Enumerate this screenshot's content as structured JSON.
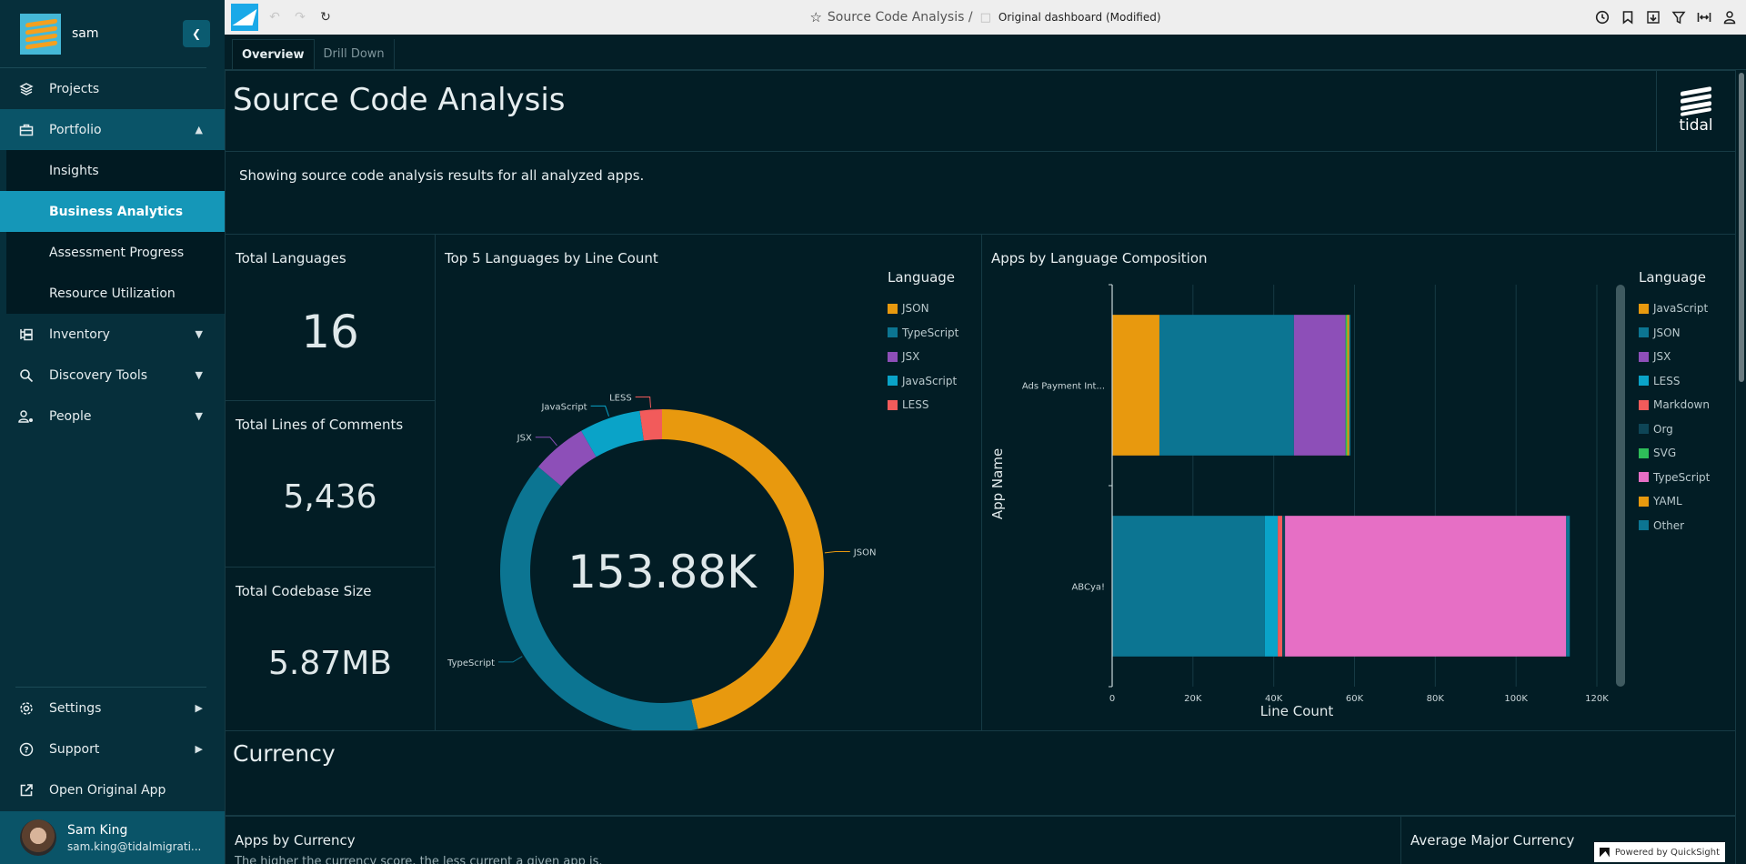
{
  "sidebar": {
    "username": "sam",
    "nav": [
      {
        "label": "Projects",
        "icon": "layers-icon"
      },
      {
        "label": "Portfolio",
        "icon": "briefcase-icon",
        "expanded": true
      },
      {
        "label": "Inventory",
        "icon": "inventory-icon"
      },
      {
        "label": "Discovery Tools",
        "icon": "search-icon"
      },
      {
        "label": "People",
        "icon": "people-settings-icon"
      }
    ],
    "portfolio_sub": [
      {
        "label": "Insights"
      },
      {
        "label": "Business Analytics",
        "active": true
      },
      {
        "label": "Assessment Progress"
      },
      {
        "label": "Resource Utilization"
      }
    ],
    "bottom": [
      {
        "label": "Settings",
        "icon": "gear-icon"
      },
      {
        "label": "Support",
        "icon": "help-icon"
      },
      {
        "label": "Open Original App",
        "icon": "external-link-icon"
      }
    ],
    "profile": {
      "name": "Sam King",
      "email": "sam.king@tidalmigrati..."
    }
  },
  "topbar": {
    "title": "Source Code Analysis /",
    "subtitle": "Original dashboard (Modified)",
    "right_icons": [
      "clock-icon",
      "bookmark-icon",
      "download-icon",
      "filter-icon",
      "fit-width-icon",
      "user-icon"
    ]
  },
  "tabs": [
    {
      "label": "Overview",
      "active": true
    },
    {
      "label": "Drill Down"
    }
  ],
  "dashboard": {
    "title": "Source Code Analysis",
    "logo_text": "tidal",
    "description": "Showing source code analysis results for all analyzed apps.",
    "kpis": [
      {
        "title": "Total Languages",
        "value": "16"
      },
      {
        "title": "Total Lines of Comments",
        "value": "5,436"
      },
      {
        "title": "Total Codebase Size",
        "value": "5.87MB"
      }
    ],
    "section_title": "Currency",
    "bottom_panels": [
      {
        "title": "Apps by Currency",
        "subtitle": "The higher the currency score, the less current a given app is."
      },
      {
        "title": "Average Major Currency"
      }
    ],
    "powered_by": "Powered by QuickSight"
  },
  "chart_data": [
    {
      "type": "pie",
      "title": "Top 5 Languages by Line Count",
      "center_label": "153.88K",
      "legend_title": "Language",
      "legend_position": "right",
      "slices": [
        {
          "label": "JSON",
          "value": 71.4,
          "color": "#e8990e"
        },
        {
          "label": "TypeScript",
          "value": 61.1,
          "color": "#0c7592"
        },
        {
          "label": "JSX",
          "value": 8.5,
          "color": "#8d4fb8"
        },
        {
          "label": "JavaScript",
          "value": 9.4,
          "color": "#0aa3c8"
        },
        {
          "label": "LESS",
          "value": 3.4,
          "color": "#f25b5b"
        }
      ],
      "units": "thousand lines"
    },
    {
      "type": "bar",
      "orientation": "horizontal",
      "stacked": true,
      "title": "Apps by Language Composition",
      "xlabel": "Line Count",
      "ylabel": "App Name",
      "xlim": [
        0,
        120000
      ],
      "xticks": [
        "0",
        "20K",
        "40K",
        "60K",
        "80K",
        "100K",
        "120K"
      ],
      "categories": [
        "Ads Payment Int...",
        "ABCya!"
      ],
      "legend_title": "Language",
      "legend_position": "right",
      "series": [
        {
          "name": "JavaScript",
          "color": "#e8990e",
          "values": [
            11700,
            0
          ]
        },
        {
          "name": "JSON",
          "color": "#0c7592",
          "values": [
            33300,
            37800
          ]
        },
        {
          "name": "JSX",
          "color": "#8d4fb8",
          "values": [
            12800,
            0
          ]
        },
        {
          "name": "LESS",
          "color": "#0aa3c8",
          "values": [
            0,
            3200
          ]
        },
        {
          "name": "Markdown",
          "color": "#f25b5b",
          "values": [
            0,
            1100
          ]
        },
        {
          "name": "Org",
          "color": "#0e4556",
          "values": [
            0,
            700
          ]
        },
        {
          "name": "SVG",
          "color": "#2ebd59",
          "values": [
            400,
            0
          ]
        },
        {
          "name": "TypeScript",
          "color": "#e66fc5",
          "values": [
            0,
            69600
          ]
        },
        {
          "name": "YAML",
          "color": "#e8990e",
          "values": [
            500,
            0
          ]
        },
        {
          "name": "Other",
          "color": "#0c7592",
          "values": [
            300,
            900
          ]
        }
      ]
    }
  ]
}
